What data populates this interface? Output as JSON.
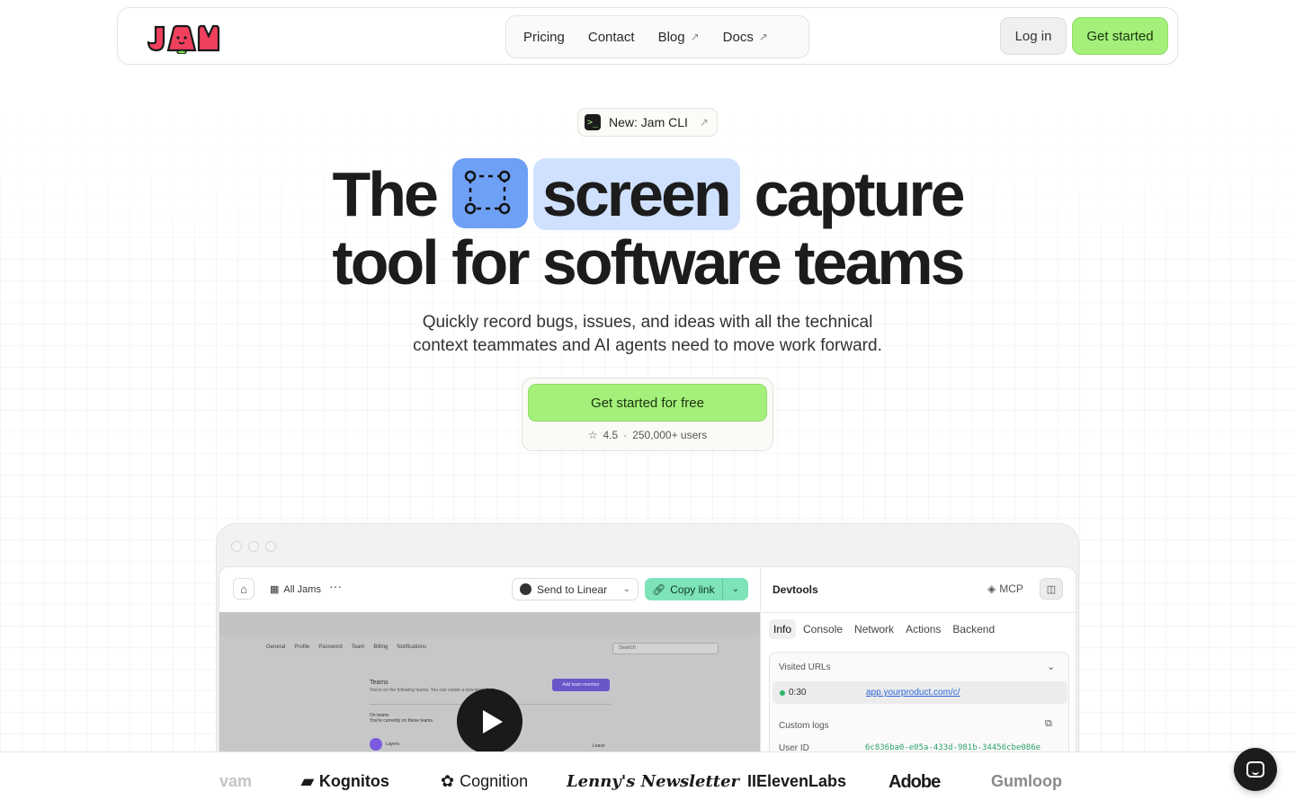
{
  "nav": {
    "logo_text": "JAM",
    "links": [
      {
        "label": "Pricing",
        "external": false
      },
      {
        "label": "Contact",
        "external": false
      },
      {
        "label": "Blog",
        "external": true
      },
      {
        "label": "Docs",
        "external": true
      }
    ],
    "login_label": "Log in",
    "get_started_label": "Get started"
  },
  "hero": {
    "badge_label": "New: Jam CLI",
    "title_the": "The",
    "title_screen": "screen",
    "title_capture": "capture",
    "title_line2": "tool for software teams",
    "subtitle_line1": "Quickly record bugs, issues, and ideas with all the technical",
    "subtitle_line2": "context teammates and AI agents need to move work forward.",
    "cta_label": "Get started for free",
    "rating": "4.5",
    "users": "250,000+ users"
  },
  "app": {
    "all_jams_label": "All Jams",
    "send_to_label": "Send to Linear",
    "copy_link_label": "Copy link",
    "video": {
      "tabs": [
        "General",
        "Profile",
        "Password",
        "Team",
        "Billing",
        "Notifications"
      ],
      "search_placeholder": "Search",
      "teams_title": "Teams",
      "teams_desc": "You're on the following teams. You can create a new team here.",
      "on_teams_title": "On teams",
      "on_teams_desc": "You're currently on these teams.",
      "add_team_member_label": "Add team member",
      "layers_label": "Layers",
      "leave_label": "Leave"
    },
    "devtools": {
      "title": "Devtools",
      "mcp_label": "MCP",
      "tabs": [
        "Info",
        "Console",
        "Network",
        "Actions",
        "Backend"
      ],
      "active_tab": "Info",
      "visited_urls_label": "Visited URLs",
      "url_time": "0:30",
      "url_value": "app.yourproduct.com/c/",
      "custom_logs_label": "Custom logs",
      "user_id_key": "User ID",
      "user_id_value": "6c836ba0-e05a-433d-981b-34456cbe086e"
    }
  },
  "customers": [
    "vam",
    "Kognitos",
    "Cognition",
    "Lenny's Newsletter",
    "IIElevenLabs",
    "Adobe",
    "Gumloop"
  ],
  "colors": {
    "accent_green": "#a4f07b",
    "selection_blue": "#6ea0f5",
    "selection_light": "#cfe1ff",
    "copy_link_green": "#7ee3b8",
    "logo_red": "#f0405e"
  }
}
